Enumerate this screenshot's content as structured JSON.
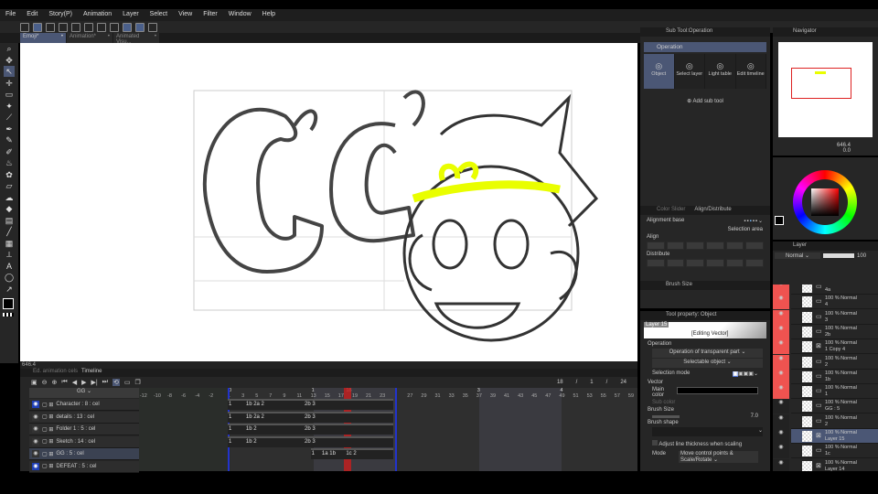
{
  "menu": [
    "File",
    "Edit",
    "Story(P)",
    "Animation",
    "Layer",
    "Select",
    "View",
    "Filter",
    "Window",
    "Help"
  ],
  "tabs": [
    {
      "label": "Emoji*",
      "active": true
    },
    {
      "label": "Animation*"
    },
    {
      "label": "Animated Visu..."
    }
  ],
  "status": {
    "zoom": "646.4"
  },
  "subtool": {
    "header": "Sub Tool:Operation",
    "group": "Operation",
    "items": [
      "Object",
      "Select layer",
      "Light table",
      "Edit timeline"
    ],
    "selected": "Object",
    "add": "Add sub tool"
  },
  "align": {
    "tabs": [
      "Color Slider",
      "Align/Distribute"
    ],
    "base_label": "Alignment base",
    "base_value": "Selection area",
    "align_label": "Align",
    "distribute_label": "Distribute"
  },
  "brushsize": {
    "header": "Brush Size"
  },
  "toolprop": {
    "header": "Tool property: Object",
    "layer": "Layer 15",
    "editing": "[Editing Vector]",
    "operation_label": "Operation",
    "op1": "Operation of transparent part",
    "op2": "Selectable object",
    "selection_mode": "Selection mode",
    "vector": "Vector",
    "main_color": "Main color",
    "sub_color": "Sub color",
    "brush_size": "Brush Size",
    "brush_size_value": "7.0",
    "brush_shape": "Brush shape",
    "adjust": "Adjust line thickness when scaling",
    "mode_label": "Mode",
    "mode_value": "Move control points & Scale/Rotate"
  },
  "navigator": {
    "header": "Navigator",
    "zoom": "646.4",
    "angle": "0.0"
  },
  "layer_panel": {
    "header": "Layer",
    "blend": "Normal",
    "opacity": "100",
    "layers": [
      {
        "line1": "",
        "line2": "4a",
        "red": true,
        "folder": true
      },
      {
        "line1": "100 % Normal",
        "line2": "4",
        "red": true,
        "folder": true
      },
      {
        "line1": "100 % Normal",
        "line2": "3",
        "red": true,
        "folder": true
      },
      {
        "line1": "100 % Normal",
        "line2": "2b",
        "red": true,
        "folder": true
      },
      {
        "line1": "100 % Normal",
        "line2": "1 Copy 4",
        "red": true,
        "folder": false
      },
      {
        "line1": "100 % Normal",
        "line2": "2",
        "red": true,
        "folder": true
      },
      {
        "line1": "100 % Normal",
        "line2": "1b",
        "red": true,
        "folder": true
      },
      {
        "line1": "100 % Normal",
        "line2": "1",
        "red": true,
        "folder": true
      },
      {
        "line1": "100 % Normal",
        "line2": "GG : 5",
        "red": false,
        "folder": true
      },
      {
        "line1": "100 % Normal",
        "line2": "2",
        "red": false,
        "folder": true
      },
      {
        "line1": "100 % Normal",
        "line2": "Layer 15",
        "red": false,
        "folder": false,
        "selected": true
      },
      {
        "line1": "100 % Normal",
        "line2": "1c",
        "red": false,
        "folder": true
      },
      {
        "line1": "100 % Normal",
        "line2": "Layer 14",
        "red": false,
        "folder": false
      }
    ]
  },
  "timeline": {
    "tabs": [
      "Ed. animation cels",
      "Timeline"
    ],
    "track": "GG",
    "current": "18",
    "fps": "1",
    "end": "24",
    "rows": [
      {
        "name": "Character : 8 : cel",
        "cels": [
          "1",
          "1b 2a 2",
          "2b 3"
        ],
        "eye": "blue"
      },
      {
        "name": "details : 13 : cel",
        "cels": [
          "1",
          "1b 2a 2",
          "2b 3"
        ]
      },
      {
        "name": "Folder 1 : 5 : cel",
        "cels": [
          "1",
          "1b 2",
          "2b 3"
        ]
      },
      {
        "name": "Sketch : 14 : cel",
        "cels": [
          "1",
          "1b 2",
          "2b 3"
        ]
      },
      {
        "name": "GG : 5 : cel",
        "cels": [
          "1",
          "1a 1b",
          "1c 2"
        ],
        "selected": true
      },
      {
        "name": "DEFEAT : 5 : cel",
        "cels": [],
        "eye": "blue"
      }
    ],
    "frame_labels": [
      "-12",
      "-10",
      "-8",
      "-6",
      "-4",
      "-2",
      "1",
      "3",
      "5",
      "7",
      "9",
      "11",
      "13",
      "15",
      "17",
      "19",
      "21",
      "23",
      "27",
      "29",
      "31",
      "33",
      "35",
      "37",
      "39",
      "41",
      "43",
      "45",
      "47",
      "49",
      "51",
      "53",
      "55",
      "57",
      "59"
    ],
    "sec_labels": [
      "0",
      "1",
      "18",
      "3",
      "4"
    ]
  },
  "colors": {
    "accent": "#4b5775",
    "highlight": "#e9fe00",
    "red": "#ef5350",
    "playhead": "#c02020"
  }
}
